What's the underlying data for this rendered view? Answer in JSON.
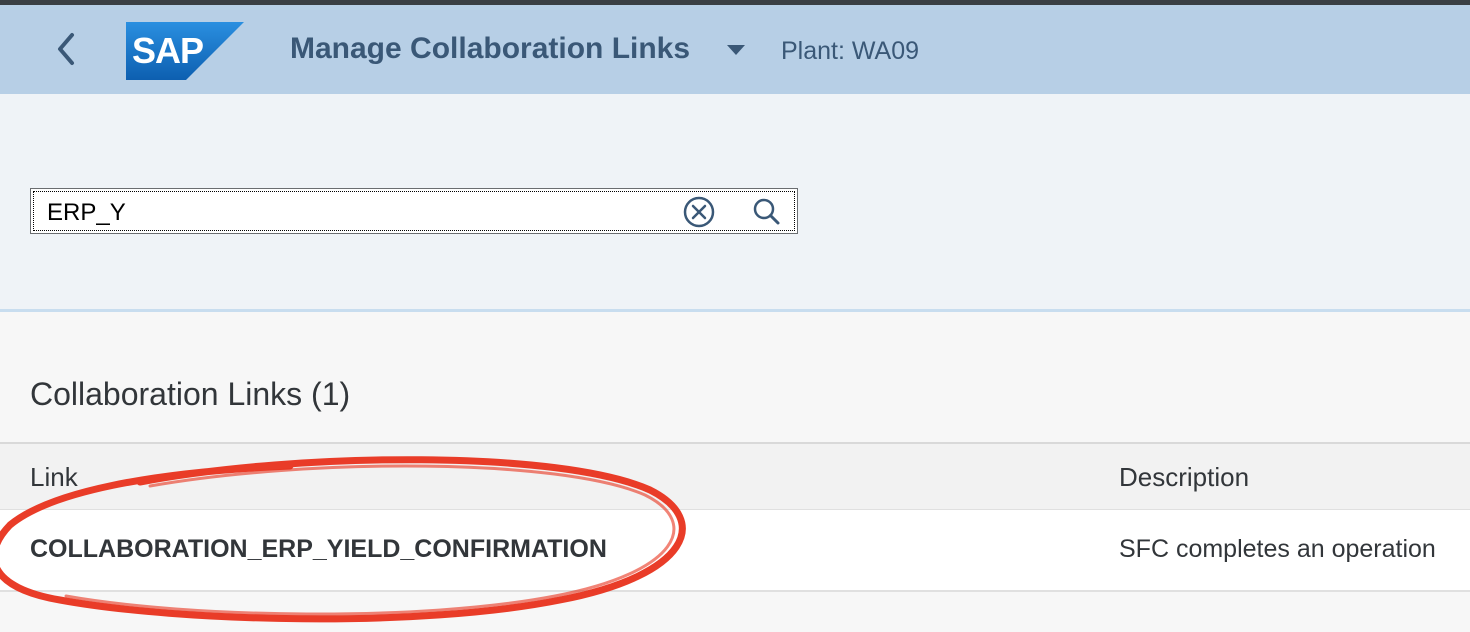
{
  "shell": {
    "logo_text": "SAP",
    "app_title": "Manage Collaboration Links",
    "plant_label": "Plant: WA09"
  },
  "search": {
    "value": "ERP_Y"
  },
  "table": {
    "title": "Collaboration Links (1)",
    "columns": [
      "Link",
      "Description"
    ],
    "rows": [
      {
        "link": "COLLABORATION_ERP_YIELD_CONFIRMATION",
        "description": "SFC completes an operation"
      }
    ]
  },
  "colors": {
    "shell_bg": "#b7cfe6",
    "title_color": "#3a5877",
    "logo_blue": "#1a73c8",
    "annotation_red": "#e8321c"
  },
  "icons": [
    "back-arrow-icon",
    "sap-logo",
    "caret-down-icon",
    "clear-icon",
    "search-icon"
  ]
}
